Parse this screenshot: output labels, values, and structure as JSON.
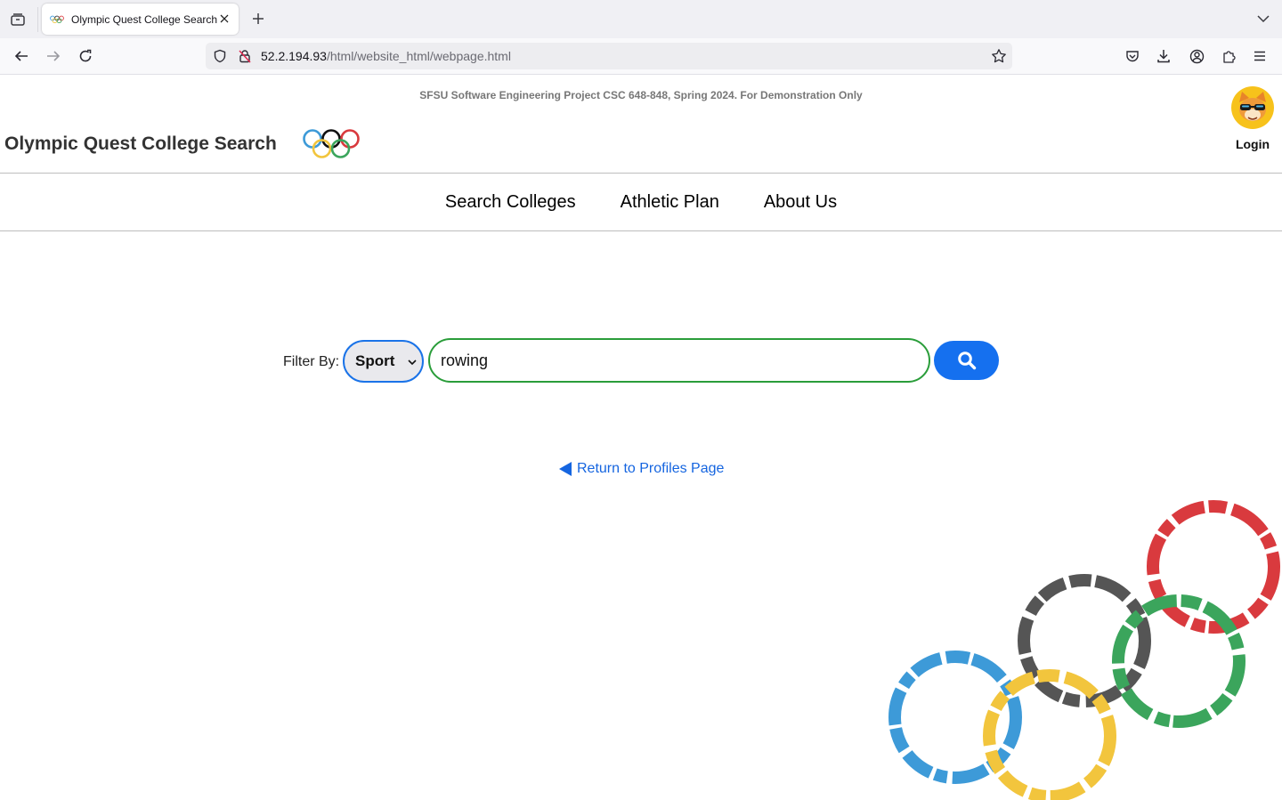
{
  "browser": {
    "tab_title": "Olympic Quest College Search",
    "url_host": "52.2.194.93",
    "url_path": "/html/website_html/webpage.html",
    "icons": [
      "tab-list-icon",
      "close-icon",
      "plus-icon",
      "chevron-down-icon",
      "back-arrow-icon",
      "forward-arrow-icon",
      "reload-icon",
      "shield-icon",
      "insecure-lock-icon",
      "star-icon",
      "pocket-icon",
      "download-icon",
      "account-icon",
      "extensions-icon",
      "menu-icon"
    ]
  },
  "site": {
    "disclaimer": "SFSU Software Engineering Project CSC 648-848, Spring 2024. For Demonstration Only",
    "title": "Olympic Quest College Search",
    "login_label": "Login",
    "nav": {
      "search_colleges": "Search Colleges",
      "athletic_plan": "Athletic Plan",
      "about_us": "About Us"
    }
  },
  "search": {
    "filter_label": "Filter By:",
    "filter_value": "Sport",
    "query_value": "rowing",
    "button_icon": "search-icon"
  },
  "return_link": {
    "label": "Return to Profiles Page",
    "icon": "left-triangle-icon"
  },
  "colors": {
    "ring_blue": "#3d9ad8",
    "ring_black": "#555555",
    "ring_red": "#d93a3e",
    "ring_yellow": "#f2c53d",
    "ring_green": "#3ba55c",
    "accent_blue": "#1570ef",
    "input_border_green": "#2a9d3a",
    "link_blue": "#1565e0"
  }
}
